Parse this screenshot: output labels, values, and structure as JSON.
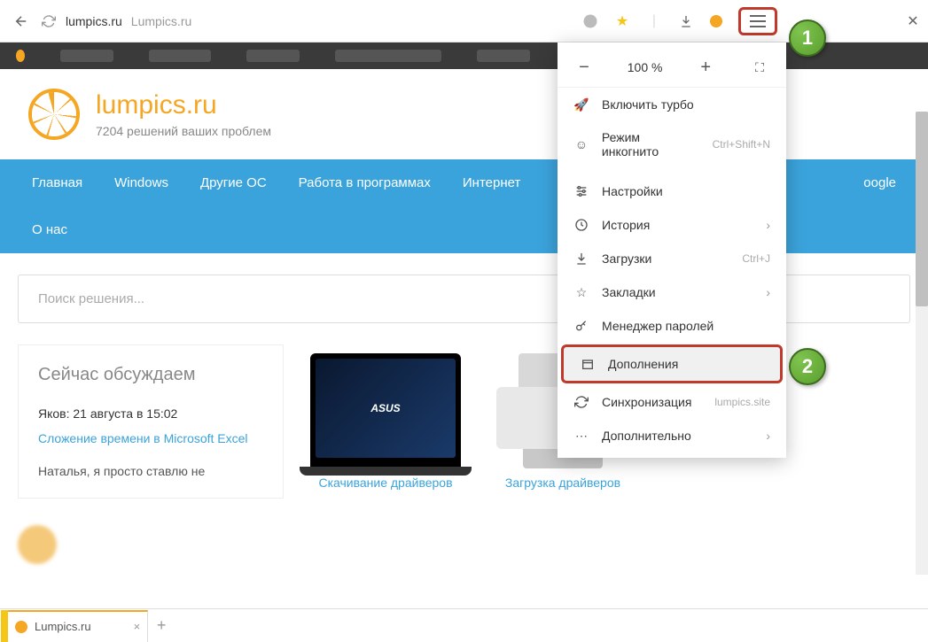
{
  "browser": {
    "url_domain": "lumpics.ru",
    "url_title": "Lumpics.ru"
  },
  "callouts": {
    "one": "1",
    "two": "2"
  },
  "tab": {
    "title": "Lumpics.ru"
  },
  "menu": {
    "zoom": "100 %",
    "turbo": "Включить турбо",
    "incognito": "Режим инкогнито",
    "incognito_shortcut": "Ctrl+Shift+N",
    "settings": "Настройки",
    "history": "История",
    "downloads": "Загрузки",
    "downloads_shortcut": "Ctrl+J",
    "bookmarks": "Закладки",
    "passwords": "Менеджер паролей",
    "addons": "Дополнения",
    "sync": "Синхронизация",
    "sync_sub": "lumpics.site",
    "more": "Дополнительно"
  },
  "site": {
    "title": "lumpics.ru",
    "tagline": "7204 решений ваших проблем"
  },
  "nav": {
    "home": "Главная",
    "windows": "Windows",
    "other_os": "Другие ОС",
    "programs": "Работа в программах",
    "internet": "Интернет",
    "google": "oogle",
    "about": "О нас"
  },
  "search": {
    "placeholder": "Поиск решения..."
  },
  "discuss": {
    "title": "Сейчас обсуждаем",
    "meta": "Яков: 21 августа в 15:02",
    "link": "Сложение времени в Microsoft Excel",
    "text": "Наталья, я просто ставлю не"
  },
  "products": {
    "laptop_brand": "ASUS",
    "laptop_link": "Скачивание драйверов",
    "printer_link": "Загрузка драйверов"
  }
}
